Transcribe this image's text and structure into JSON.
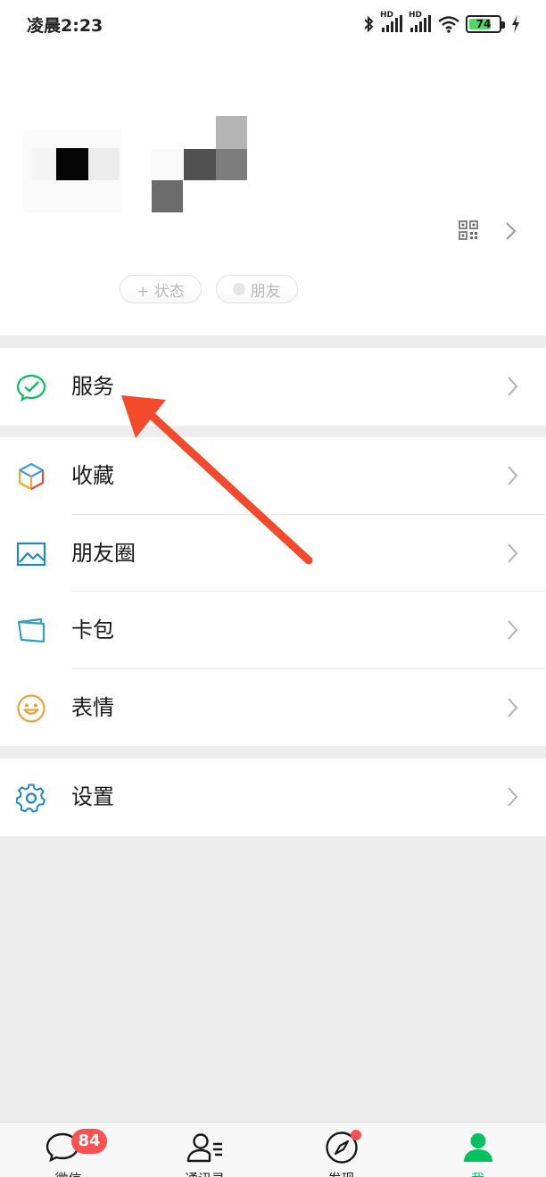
{
  "status_bar": {
    "time": "凌晨2:23",
    "battery": "74",
    "battery_level": 0.74,
    "hd_labels": [
      "HD",
      "HD"
    ],
    "icons": [
      "bluetooth-icon",
      "signal-hd-icon",
      "signal-hd-icon",
      "wifi-icon",
      "battery-icon",
      "charging-icon"
    ]
  },
  "profile": {
    "status_chip": "+ 状态",
    "friends_chip": "朋友",
    "icons": [
      "qr-code-icon",
      "chevron-right-icon"
    ]
  },
  "menu": {
    "service": "服务",
    "favorites": "收藏",
    "moments": "朋友圈",
    "cards": "卡包",
    "stickers": "表情",
    "settings": "设置"
  },
  "tabs": {
    "chats": {
      "label": "微信",
      "badge": "84"
    },
    "contacts": {
      "label": "通讯录"
    },
    "discover": {
      "label": "发现"
    },
    "me": {
      "label": "我"
    }
  },
  "colors": {
    "accent": "#07c160",
    "badge": "#fa5151",
    "annotation_arrow": "#f24a2a",
    "background": "#ededed"
  }
}
